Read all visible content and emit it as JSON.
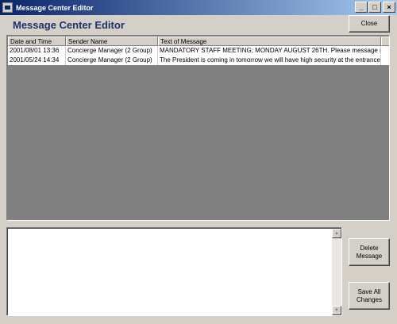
{
  "window": {
    "title": "Message Center Editor",
    "icon": "application-icon",
    "controls": {
      "minimize": "_",
      "maximize": "□",
      "close": "×"
    }
  },
  "heading": "Message Center Editor",
  "buttons": {
    "close": "Close",
    "delete": "Delete\nMessage",
    "save": "Save All\nChanges"
  },
  "table": {
    "columns": [
      "Date and Time",
      "Sender Name",
      "Text of Message"
    ],
    "rows": [
      {
        "datetime": "2001/08/01 13:36",
        "sender": "Concierge Manager  (2 Group)",
        "text": "MANDATORY STAFF MEETING;  MONDAY AUGUST 26TH.  Please message r"
      },
      {
        "datetime": "2001/05/24 14:34",
        "sender": "Concierge Manager  (2 Group)",
        "text": "The President is coming in tomorrow we will have high security at the entrance"
      }
    ]
  },
  "message_editor": {
    "value": ""
  },
  "scrollbar": {
    "up": "▲",
    "down": "▼"
  },
  "colors": {
    "titlebar_start": "#0a246a",
    "titlebar_end": "#a6caf0",
    "heading": "#1f2f6e",
    "list_background": "#808080",
    "face": "#d4d0c8"
  }
}
